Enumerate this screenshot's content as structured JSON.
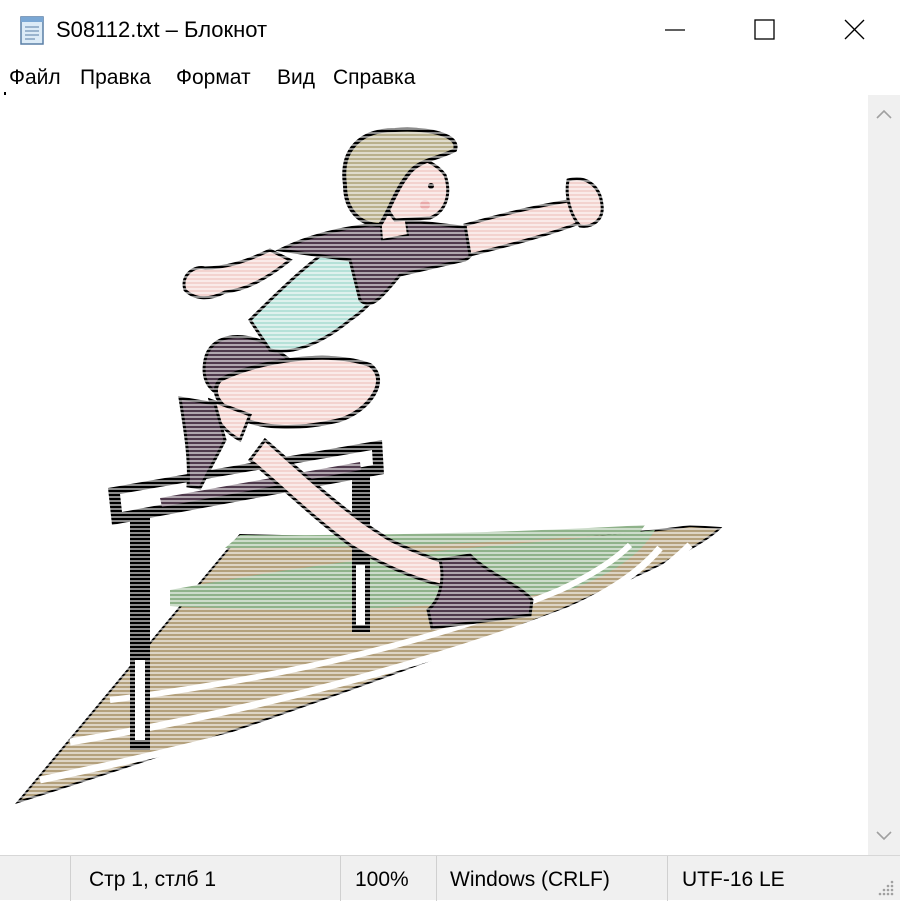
{
  "window": {
    "title": "S08112.txt – Блокнот",
    "minimize_icon": "minimize-icon",
    "maximize_icon": "maximize-icon",
    "close_icon": "close-icon"
  },
  "menu": {
    "items": [
      {
        "label": "Файл"
      },
      {
        "label": "Правка"
      },
      {
        "label": "Формат"
      },
      {
        "label": "Вид"
      },
      {
        "label": "Справка"
      }
    ]
  },
  "editor": {
    "content_description_icon": "hurdler-ascii-art-icon"
  },
  "statusbar": {
    "position": "Стр 1, стлб 1",
    "zoom": "100%",
    "line_ending": "Windows (CRLF)",
    "encoding": "UTF-16 LE"
  },
  "colors": {
    "track_green": "#8fb28a",
    "track_tan": "#b3a07c",
    "skin": "#f3d3cf",
    "hair": "#b9b08c",
    "shirt": "#b5e1d8",
    "dark_purple": "#4f3a4c",
    "outline": "#000000"
  }
}
